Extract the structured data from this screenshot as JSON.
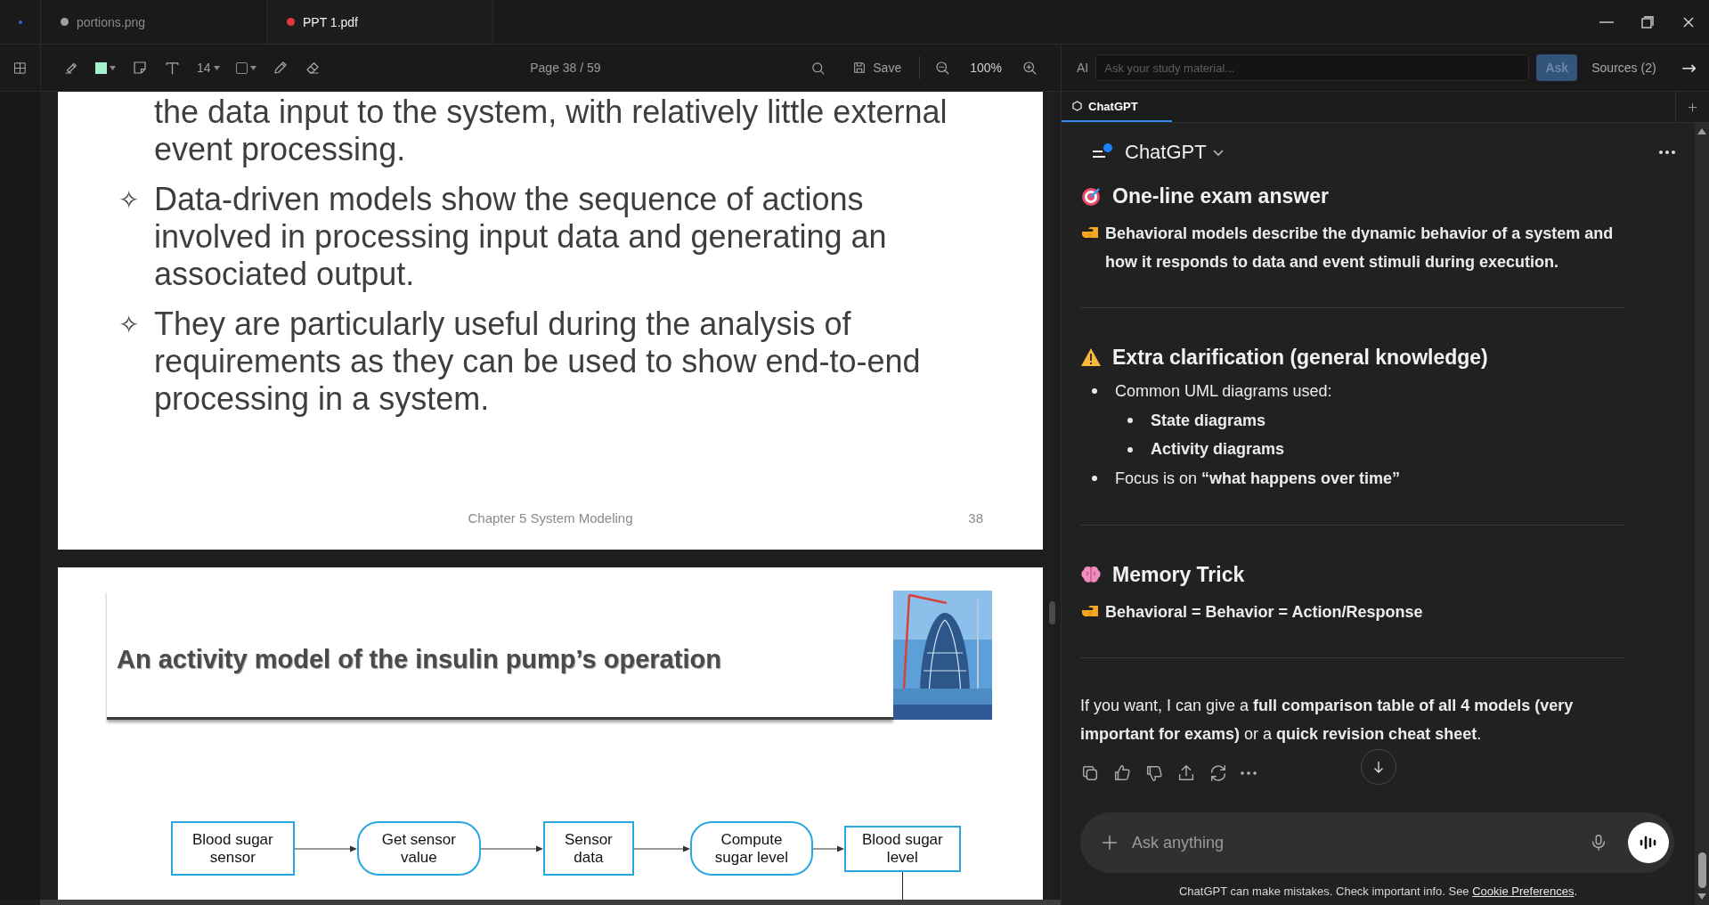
{
  "tabs": [
    {
      "label": "portions.png",
      "selected": false,
      "color": "#9e9e9e"
    },
    {
      "label": "PPT 1.pdf",
      "selected": true,
      "color": "#e5383b"
    }
  ],
  "toolbar": {
    "font_size": "14",
    "page": "Page 38 / 59",
    "save": "Save",
    "zoom": "100%"
  },
  "ai_bar": {
    "label": "AI",
    "placeholder": "Ask your study material...",
    "ask": {
      "label": "Ask",
      "disabled": true
    },
    "sources": "Sources (2)",
    "arrow": "→"
  },
  "panel_tabs": [
    {
      "label": "ChatGPT",
      "selected": true
    }
  ],
  "slides": [
    {
      "kind": "bullets",
      "items": [
        {
          "text": "the data input to the system, with relatively little external event processing."
        },
        {
          "marker": "✧",
          "text": "Data-driven models show the sequence of actions involved in processing input data and generating an associated output."
        },
        {
          "marker": "✧",
          "text": "They are particularly useful during the analysis of requirements as they can be used to show end-to-end processing in a system."
        }
      ],
      "footer": "Chapter 5 System Modeling",
      "number": "38"
    },
    {
      "kind": "diagram",
      "title": "An activity model of the insulin pump’s operation",
      "nodes": [
        {
          "kind": "data",
          "lines": [
            "Blood sugar",
            "sensor"
          ]
        },
        {
          "kind": "activity",
          "lines": [
            "Get sensor",
            "value"
          ]
        },
        {
          "kind": "data",
          "lines": [
            "Sensor",
            "data"
          ]
        },
        {
          "kind": "activity",
          "lines": [
            "Compute",
            "sugar level"
          ]
        },
        {
          "kind": "data",
          "lines": [
            "Blood sugar",
            "level"
          ]
        }
      ]
    }
  ],
  "chat": {
    "title": "ChatGPT",
    "sections": [
      {
        "kind": "target",
        "heading": "One-line exam answer",
        "blocks": [
          {
            "kind": "pointer",
            "text": "Behavioral models describe the dynamic behavior of a system and how it responds to data and event stimuli during execution.",
            "bold": true
          }
        ]
      },
      {
        "kind": "warning",
        "heading": "Extra clarification (general knowledge)",
        "blocks": [
          {
            "kind": "list",
            "items": [
              {
                "text": "Common UML diagrams used:",
                "bold": false,
                "children": [
                  {
                    "text": "State diagrams",
                    "bold": true
                  },
                  {
                    "text": "Activity diagrams",
                    "bold": true
                  }
                ]
              },
              {
                "text": "Focus is on **“what happens over time”**",
                "bold": false
              }
            ]
          }
        ]
      },
      {
        "kind": "brain",
        "heading": "Memory Trick",
        "blocks": [
          {
            "kind": "pointer",
            "text": "Behavioral = Behavior = Action/Response",
            "bold": true
          }
        ]
      }
    ],
    "closing": "If you want, I can give a **full comparison table of all 4 models (very important for exams)** or a **quick revision cheat sheet**.",
    "composer": {
      "placeholder": "Ask anything"
    },
    "disclaimer": "ChatGPT can make mistakes. Check important info. See",
    "link": "Cookie Preferences",
    "disclaimer_end": "."
  }
}
